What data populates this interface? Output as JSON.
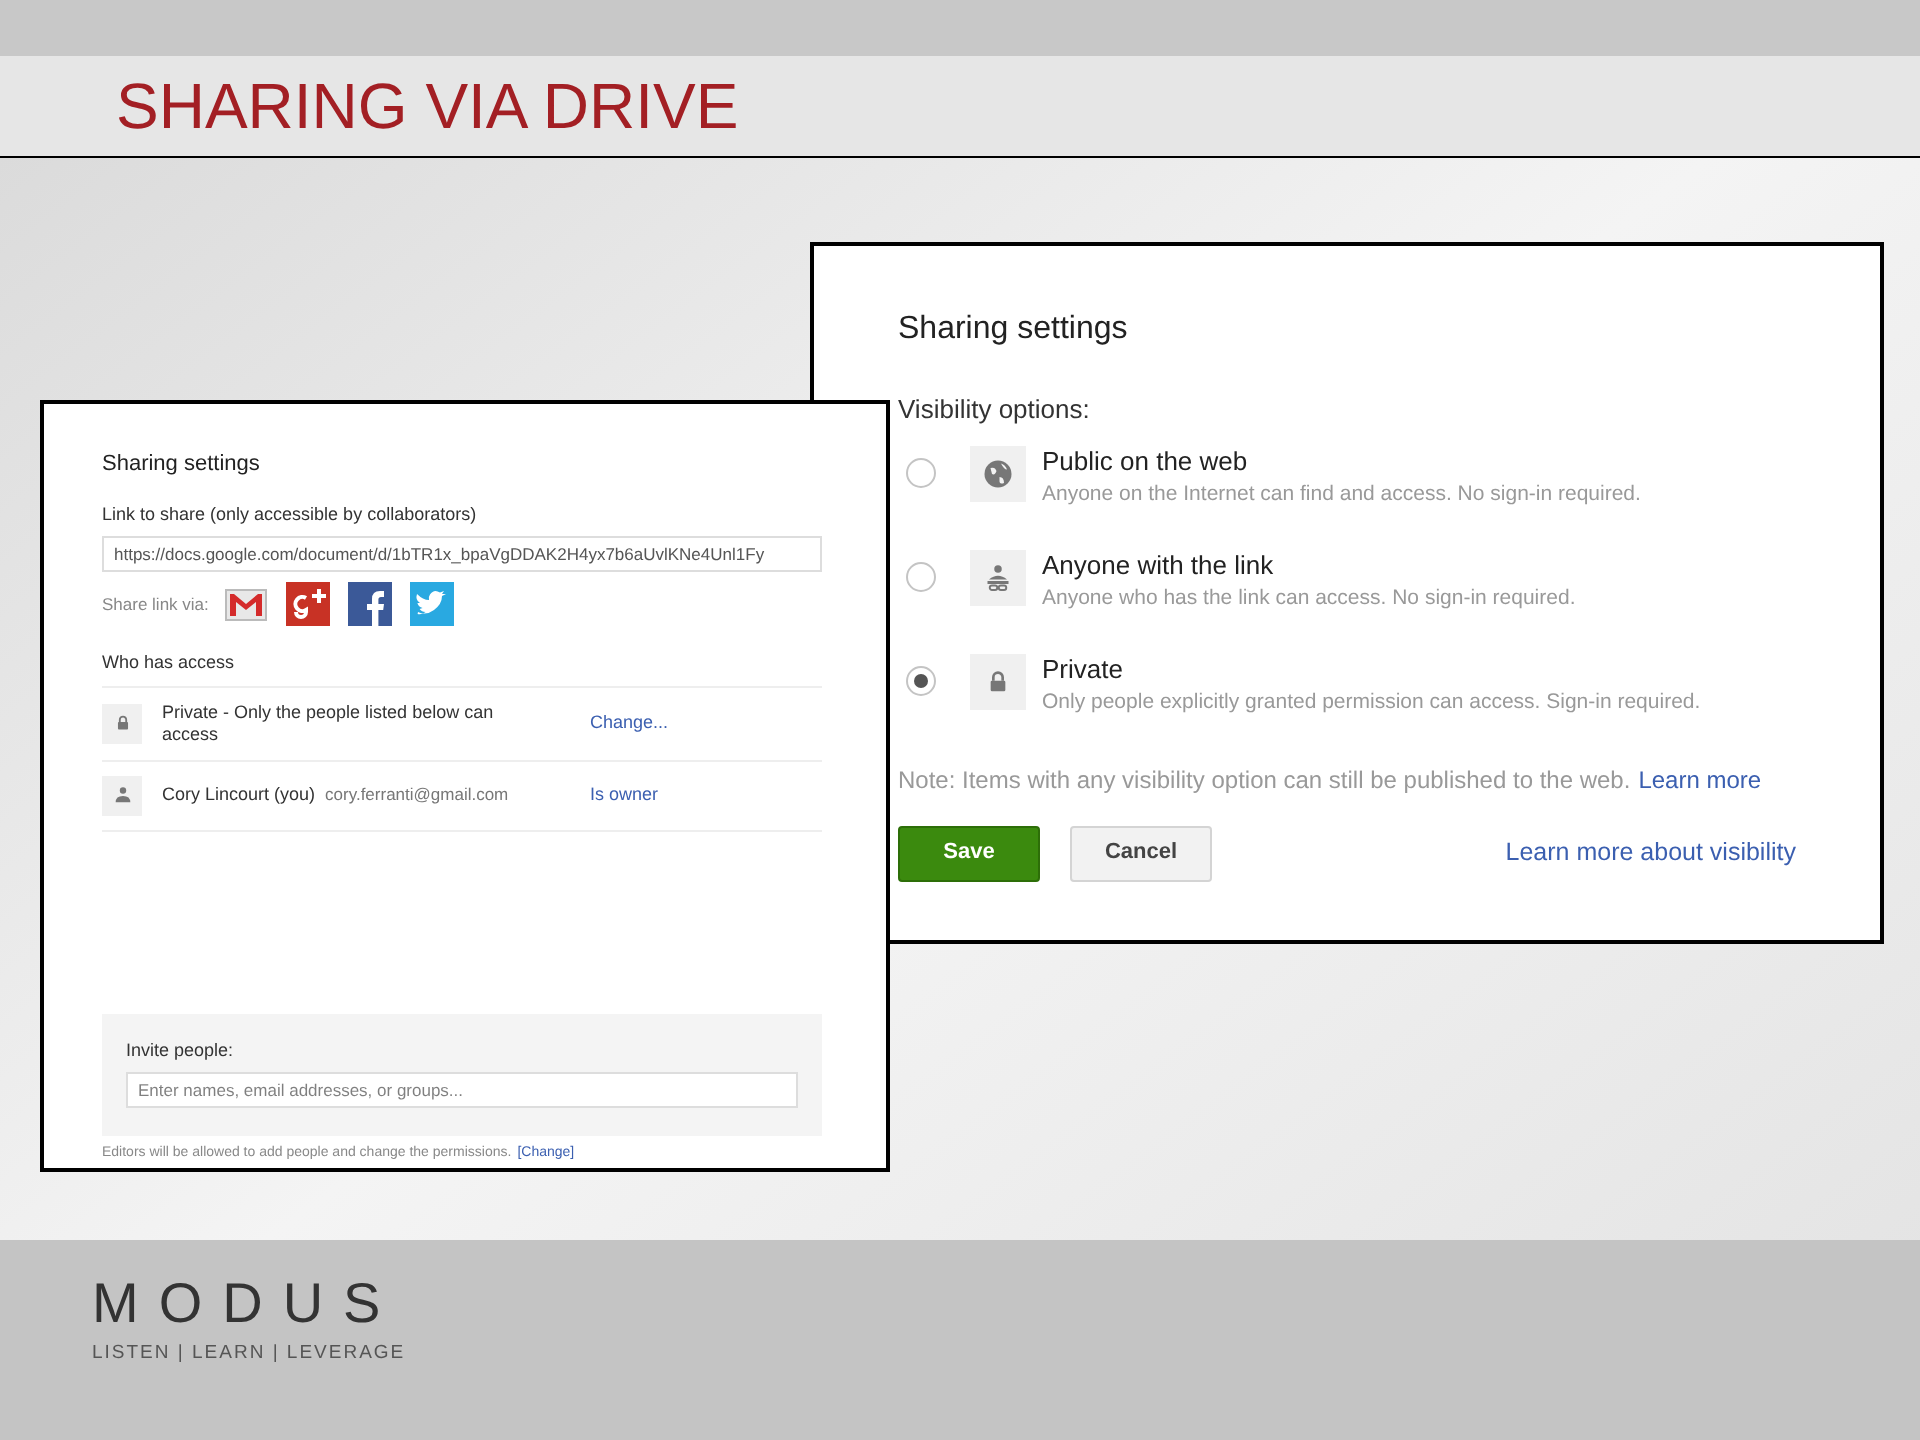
{
  "slide_title": "SHARING VIA DRIVE",
  "link_dialog": {
    "title": "Sharing settings",
    "link_label": "Link to share (only accessible by collaborators)",
    "link_value": "https://docs.google.com/document/d/1bTR1x_bpaVgDDAK2H4yx7b6aUvlKNe4Unl1Fy",
    "share_via_label": "Share link via:",
    "share_services": [
      {
        "kind": "gmail"
      },
      {
        "kind": "googleplus"
      },
      {
        "kind": "facebook"
      },
      {
        "kind": "twitter"
      }
    ],
    "access_heading": "Who has access",
    "access_rows": [
      {
        "kind": "lock",
        "text": "Private - Only the people listed below can access",
        "action": "Change..."
      },
      {
        "kind": "person",
        "text": "Cory Lincourt (you)",
        "email": "cory.ferranti@gmail.com",
        "action": "Is owner"
      }
    ],
    "invite_label": "Invite people:",
    "invite_placeholder": "Enter names, email addresses, or groups...",
    "footer_note": "Editors will be allowed to add people and change the permissions.",
    "footer_link": "[Change]"
  },
  "visibility_dialog": {
    "title": "Sharing settings",
    "options_label": "Visibility options:",
    "options": [
      {
        "kind": "globe",
        "label": "Public on the web",
        "description": "Anyone on the Internet can find and access. No sign-in required.",
        "selected": false
      },
      {
        "kind": "link",
        "label": "Anyone with the link",
        "description": "Anyone who has the link can access. No sign-in required.",
        "selected": false
      },
      {
        "kind": "lock",
        "label": "Private",
        "description": "Only people explicitly granted permission can access. Sign-in required.",
        "selected": true
      }
    ],
    "note": "Note: Items with any visibility option can still be published to the web.",
    "note_link": "Learn more",
    "buttons": [
      {
        "kind": "primary",
        "label": "Save"
      },
      {
        "kind": "secondary",
        "label": "Cancel"
      }
    ],
    "help_link": "Learn more about visibility"
  },
  "logo": {
    "name": "MODUS",
    "tagline": "LISTEN | LEARN | LEVERAGE"
  }
}
